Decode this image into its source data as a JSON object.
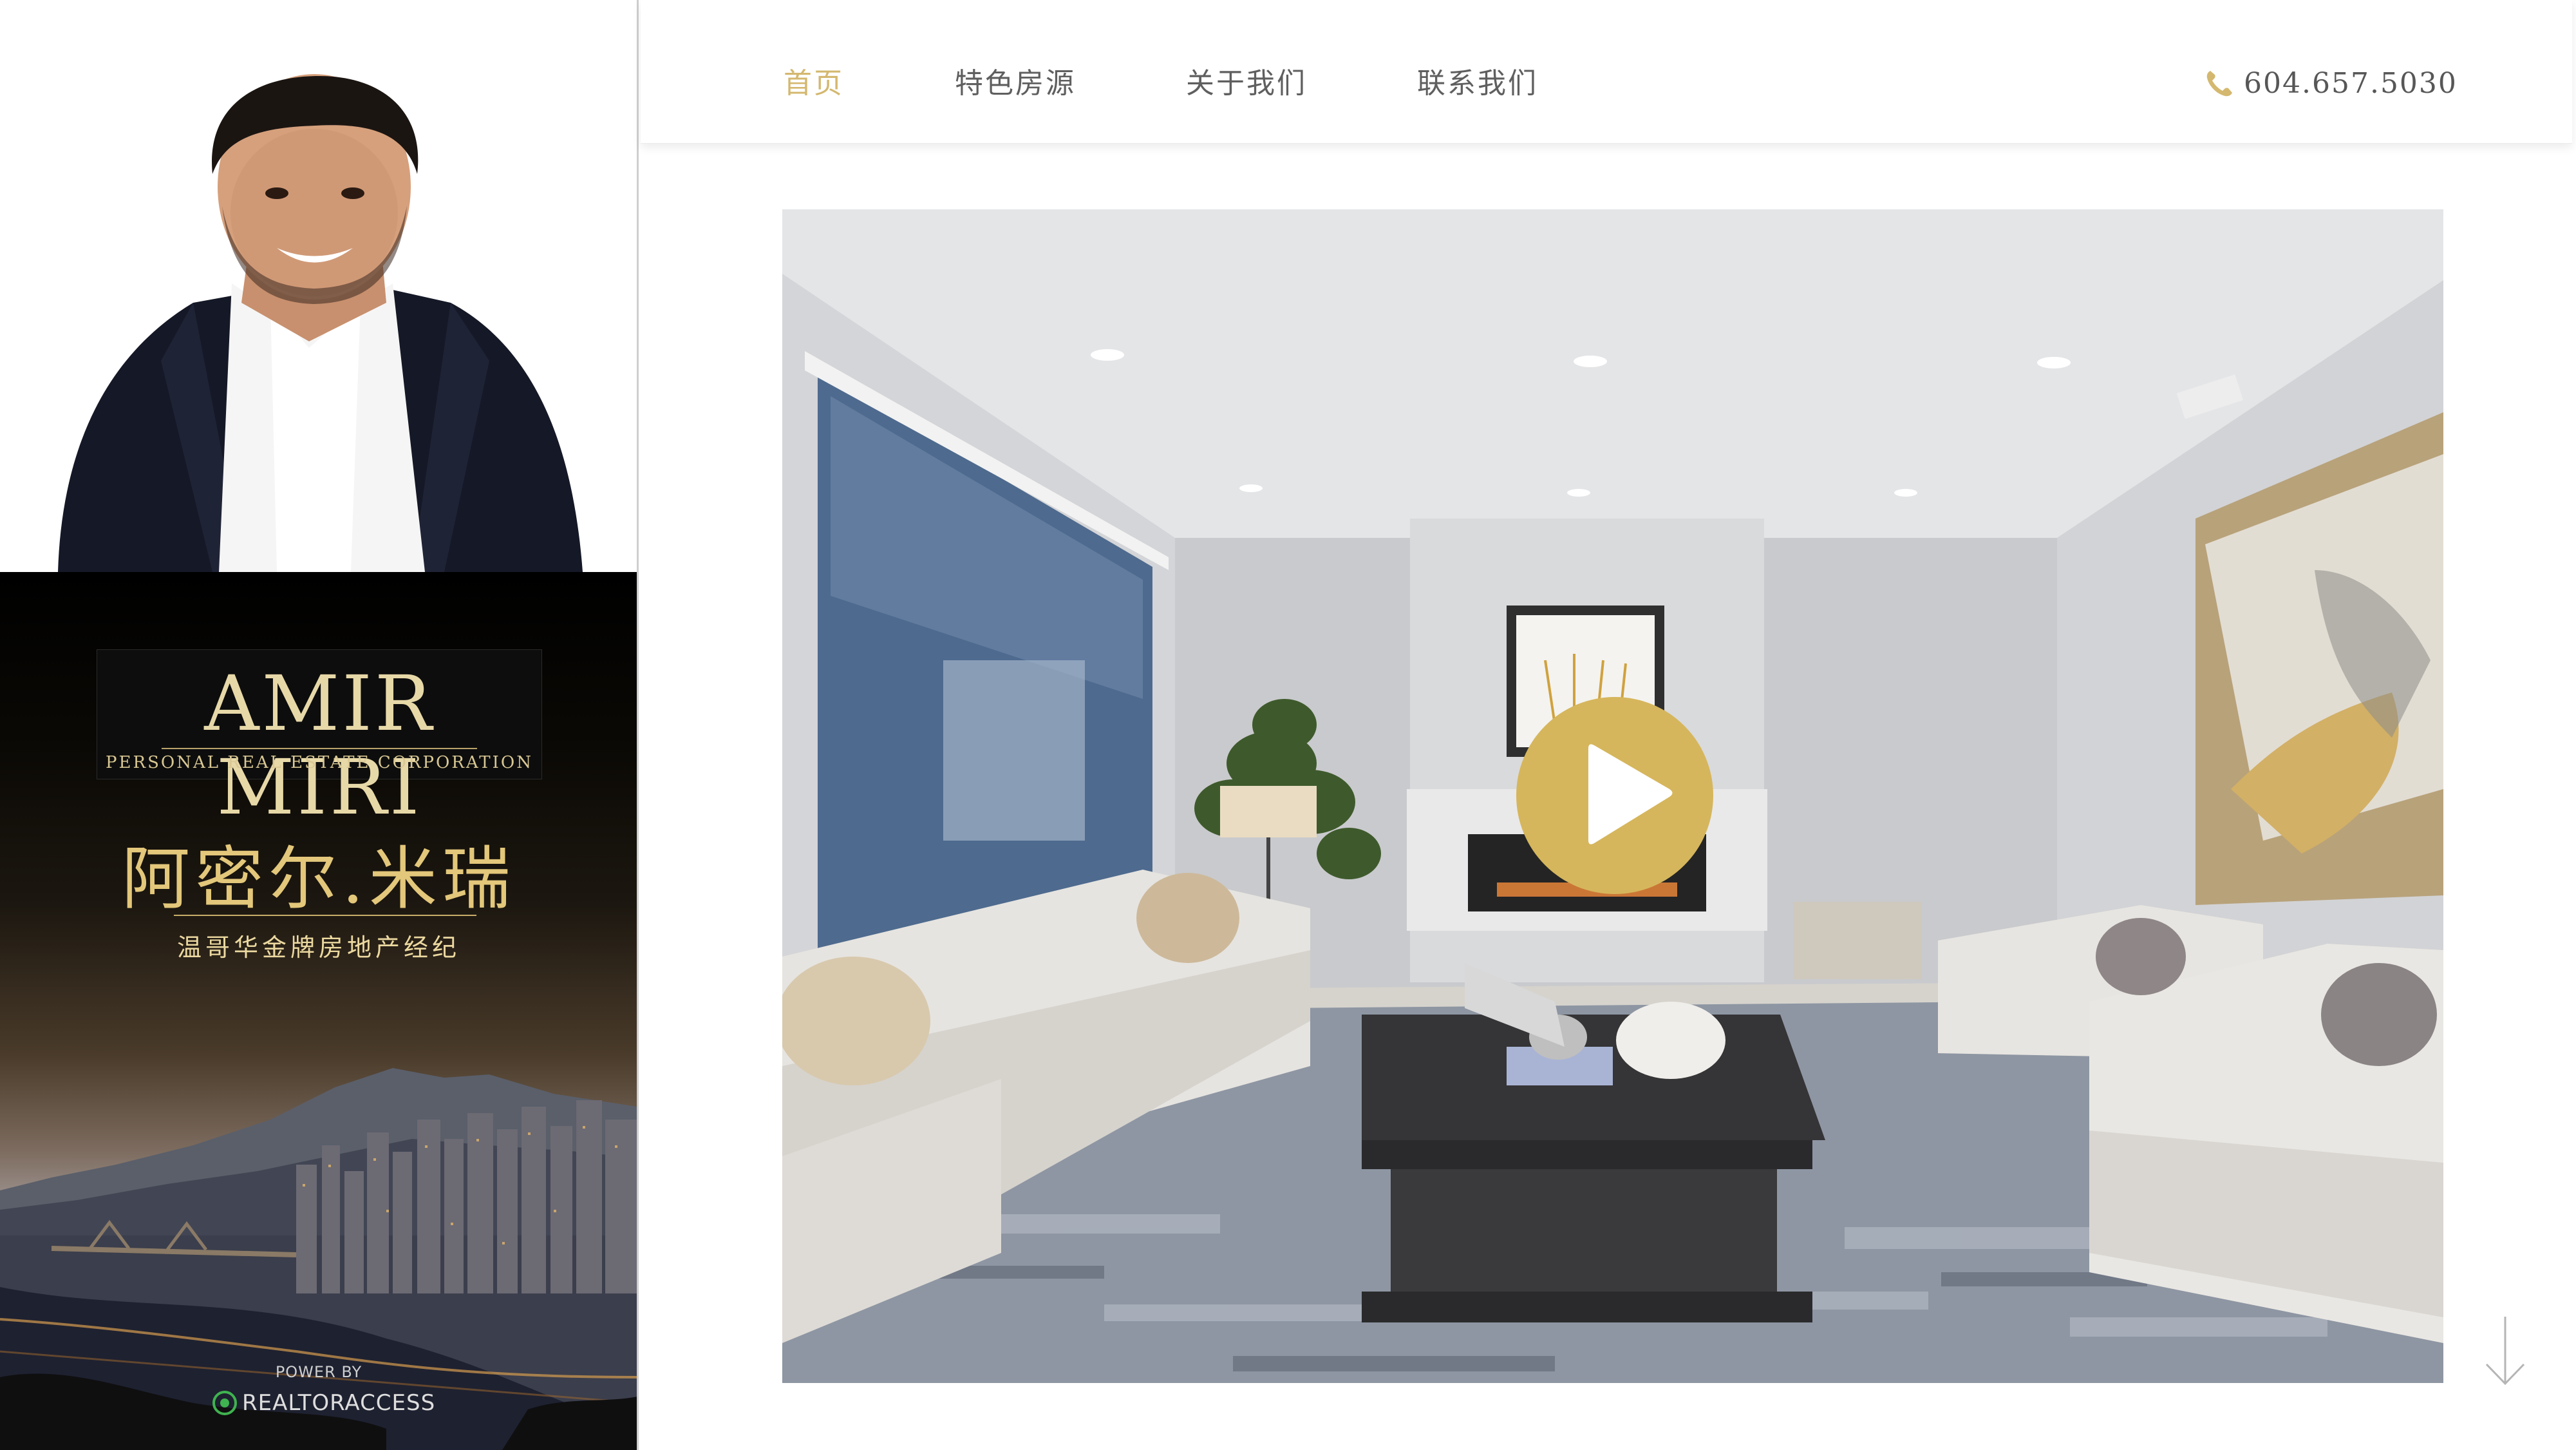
{
  "agent": {
    "logo_name": "AMIR MIRI",
    "logo_subtitle": "PERSONAL REAL ESTATE CORPORATION",
    "name_cn": "阿密尔.米瑞",
    "title_cn": "温哥华金牌房地产经纪",
    "power_by": "POWER BY",
    "platform": "REALTORACCESS"
  },
  "nav": {
    "items": [
      {
        "label": "首页",
        "active": true
      },
      {
        "label": "特色房源",
        "active": false
      },
      {
        "label": "关于我们",
        "active": false
      },
      {
        "label": "联系我们",
        "active": false
      }
    ],
    "phone": "604.657.5030"
  },
  "colors": {
    "accent_gold": "#d4b86f",
    "play_button": "#d6b65c",
    "nav_text": "#5f5f5f"
  },
  "icons": {
    "phone": "phone-icon",
    "play": "play-icon",
    "scroll": "arrow-down-icon",
    "platform": "realtoraccess-logo-icon"
  }
}
